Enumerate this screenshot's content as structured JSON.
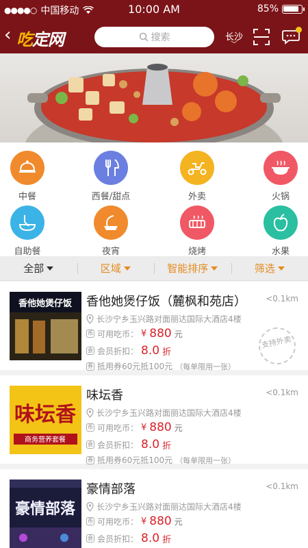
{
  "status_bar": {
    "carrier": "中国移动",
    "time": "10:00 AM",
    "battery": "85%"
  },
  "header": {
    "logo_text": "吃定网",
    "search_placeholder": "搜索",
    "city": "长沙"
  },
  "categories": [
    {
      "label": "中餐",
      "color": "#f08a2c",
      "icon": "cloche-icon"
    },
    {
      "label": "西餐/甜点",
      "color": "#6b7fe0",
      "icon": "fork-knife-icon"
    },
    {
      "label": "外卖",
      "color": "#f4b320",
      "icon": "scooter-icon"
    },
    {
      "label": "火锅",
      "color": "#f05865",
      "icon": "hotpot-icon"
    },
    {
      "label": "自助餐",
      "color": "#3cb3e6",
      "icon": "buffet-icon"
    },
    {
      "label": "夜宵",
      "color": "#f08a2c",
      "icon": "night-snack-icon"
    },
    {
      "label": "烧烤",
      "color": "#f05865",
      "icon": "bbq-icon"
    },
    {
      "label": "水果",
      "color": "#29bfa0",
      "icon": "apple-icon"
    }
  ],
  "filters": [
    {
      "label": "全部"
    },
    {
      "label": "区域"
    },
    {
      "label": "智能排序"
    },
    {
      "label": "筛选"
    }
  ],
  "restaurants": [
    {
      "name": "香他她煲仔饭（麓枫和苑店）",
      "distance": "<0.1km",
      "address": "长沙宁乡玉兴路对面丽达国际大酒店4楼",
      "available_label": "可用吃币：",
      "currency": "¥",
      "price": "880",
      "unit": "元",
      "member_label": "会员折扣：",
      "discount": "8.0",
      "discount_unit": "折",
      "voucher": "抵用券60元抵100元",
      "voucher_note": "（每单限用一张）",
      "stamp": "支持外卖",
      "thumb_text": "香他她煲仔饭"
    },
    {
      "name": "味坛香",
      "distance": "<0.1km",
      "address": "长沙宁乡玉兴路对面丽达国际大酒店4楼",
      "available_label": "可用吃币：",
      "currency": "¥",
      "price": "880",
      "unit": "元",
      "member_label": "会员折扣：",
      "discount": "8.0",
      "discount_unit": "折",
      "voucher": "抵用券60元抵100元",
      "voucher_note": "（每单限用一张）",
      "thumb_text": "味坛香",
      "thumb_sub": "商务营养套餐"
    },
    {
      "name": "豪情部落",
      "distance": "<0.1km",
      "address": "长沙宁乡玉兴路对面丽达国际大酒店4楼",
      "available_label": "可用吃币：",
      "currency": "¥",
      "price": "880",
      "unit": "元",
      "member_label": "会员折扣：",
      "discount": "8.0",
      "discount_unit": "折",
      "thumb_text": "豪情部落"
    }
  ],
  "colors": {
    "brand": "#7b1418",
    "price": "#d8232a",
    "filter_accent": "#e58a1f"
  }
}
